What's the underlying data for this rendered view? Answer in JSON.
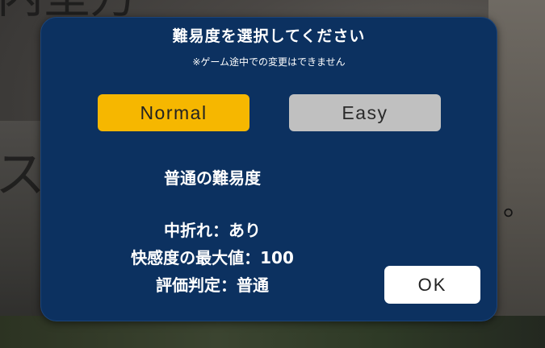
{
  "dialog": {
    "title": "難易度を選択してください",
    "note": "※ゲーム途中での変更はできません",
    "difficulty_options": [
      {
        "label": "Normal",
        "selected": true
      },
      {
        "label": "Easy",
        "selected": false
      }
    ],
    "description": {
      "name": "普通の難易度",
      "lines": [
        "中折れ：あり",
        "快感度の最大値：100",
        "評価判定：普通"
      ]
    },
    "ok_label": "OK"
  },
  "colors": {
    "dialog_bg": "#0c3160",
    "selected_button": "#f6b700",
    "unselected_button": "#c0c0c0",
    "ok_button": "#ffffff"
  }
}
